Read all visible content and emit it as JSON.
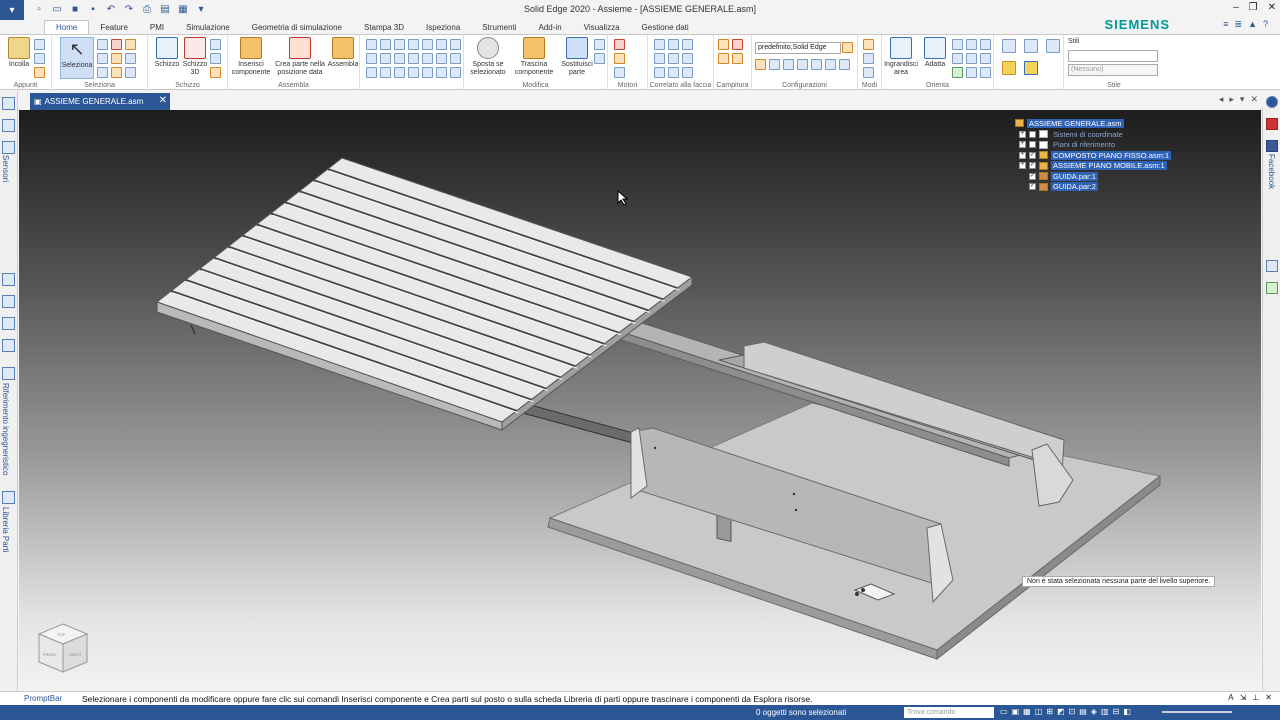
{
  "window": {
    "title": "Solid Edge 2020 - Assieme - [ASSIEME GENERALE.asm]",
    "brand": "SIEMENS"
  },
  "ribbon": {
    "tabs": [
      "Home",
      "Feature",
      "PMI",
      "Simulazione",
      "Geometria di simulazione",
      "Stampa 3D",
      "Ispeziona",
      "Strumenti",
      "Add-in",
      "Visualizza",
      "Gestione dati"
    ],
    "active_tab": "Home",
    "groups": {
      "appunti": {
        "label": "Appunti",
        "incolla": "Incolla"
      },
      "seleziona": {
        "label": "Seleziona",
        "seleziona": "Seleziona"
      },
      "schizzo": {
        "label": "Schizzo",
        "schizzo": "Schizzo",
        "schizzo3d": "Schizzo\n3D"
      },
      "assembla": {
        "label": "Assembla",
        "inserisci": "Inserisci componente",
        "crea": "Crea parte nella posizione data",
        "assembla": "Assembla"
      },
      "modifica": {
        "label": "Modifica",
        "sposta": "Sposta se selezionato",
        "trascina": "Trascina componente",
        "sostituisci": "Sostituisci parte"
      },
      "motori": {
        "label": "Motori"
      },
      "correlato": {
        "label": "Correlato alla faccia"
      },
      "campitura": {
        "label": "Campitura"
      },
      "configurazioni": {
        "label": "Configurazioni",
        "combo_value": "predefinito,Solid Edge"
      },
      "modi": {
        "label": "Modi"
      },
      "orienta": {
        "label": "Orienta",
        "ingrandisci": "Ingrandisci area",
        "adatta": "Adatta"
      },
      "stile": {
        "label": "Stile",
        "stili": "Stili",
        "combo1": "",
        "combo2": "(Nessuno)"
      }
    }
  },
  "document": {
    "tab_name": "ASSIEME GENERALE.asm"
  },
  "left_panel": {
    "labels": [
      "Sensori",
      "Riferimento ingegneristico",
      "Libreria Parti"
    ]
  },
  "right_panel": {
    "labels": [
      "Facebook"
    ]
  },
  "tree": {
    "root": "ASSIEME GENERALE.asm",
    "items": [
      {
        "label": "Sistemi di coordinate",
        "checked": false,
        "expandable": true,
        "style": "dim"
      },
      {
        "label": "Piani di riferimento",
        "checked": false,
        "expandable": true,
        "style": "dim"
      },
      {
        "label": "COMPOSTO PIANO FISSO.asm:1",
        "checked": true,
        "expandable": true,
        "style": "plain"
      },
      {
        "label": "ASSIEME PIANO MOBILE.asm:1",
        "checked": true,
        "expandable": true,
        "style": "plain"
      },
      {
        "label": "GUIDA.par:1",
        "checked": true,
        "expandable": false,
        "style": "plain"
      },
      {
        "label": "GUIDA.par:2",
        "checked": true,
        "expandable": false,
        "style": "plain"
      }
    ]
  },
  "viewport": {
    "tooltip": "Non è stata selezionata nessuna parte del livello superiore.",
    "viewcube_labels": [
      "TOP",
      "FRONT",
      "RIGHT"
    ]
  },
  "prompt_bar": {
    "label": "PromptBar",
    "text": "Selezionare i componenti da modificare oppure fare clic sui comandi Inserisci componente e Crea parti sul posto o sulla scheda Libreria di parti oppure trascinare i componenti da Esplora risorse."
  },
  "status_bar": {
    "text": "0 oggetti sono selezionati",
    "find_placeholder": "Trova comando"
  }
}
